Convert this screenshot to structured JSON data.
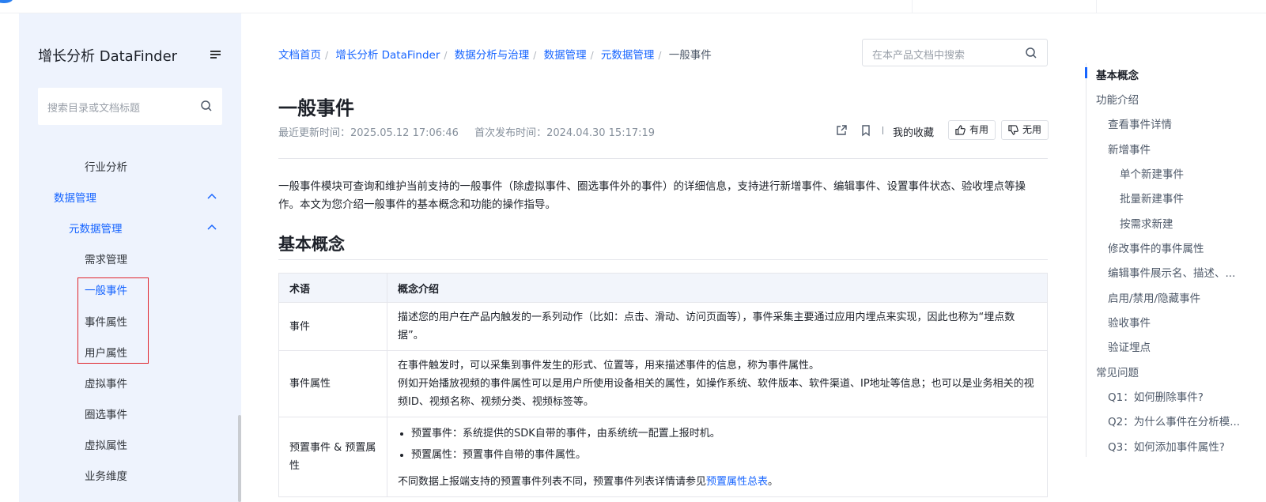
{
  "sidebar": {
    "title": "增长分析 DataFinder",
    "search_placeholder": "搜索目录或文档标题",
    "items": [
      {
        "label": "行业分析"
      },
      {
        "label": "数据管理"
      },
      {
        "label": "元数据管理"
      },
      {
        "label": "需求管理"
      },
      {
        "label": "一般事件"
      },
      {
        "label": "事件属性"
      },
      {
        "label": "用户属性"
      },
      {
        "label": "虚拟事件"
      },
      {
        "label": "圈选事件"
      },
      {
        "label": "虚拟属性"
      },
      {
        "label": "业务维度"
      }
    ]
  },
  "breadcrumb": [
    "文档首页",
    "增长分析 DataFinder",
    "数据分析与治理",
    "数据管理",
    "元数据管理",
    "一般事件"
  ],
  "doc_search_placeholder": "在本产品文档中搜索",
  "doc": {
    "title": "一般事件",
    "updated": "最近更新时间：2025.05.12 17:06:46",
    "published": "首次发布时间：2024.04.30 15:17:19",
    "favorites": "我的收藏",
    "useful": "有用",
    "useless": "无用",
    "intro": "一般事件模块可查询和维护当前支持的一般事件（除虚拟事件、圈选事件外的事件）的详细信息，支持进行新增事件、编辑事件、设置事件状态、验收埋点等操作。本文为您介绍一般事件的基本概念和功能的操作指导。",
    "section_title": "基本概念",
    "table": {
      "headers": [
        "术语",
        "概念介绍"
      ],
      "rows": [
        {
          "term": "事件",
          "desc": "描述您的用户在产品内触发的一系列动作（比如：点击、滑动、访问页面等），事件采集主要通过应用内埋点来实现，因此也称为“埋点数据”。"
        },
        {
          "term": "事件属性",
          "desc1": "在事件触发时，可以采集到事件发生的形式、位置等，用来描述事件的信息，称为事件属性。",
          "desc2": "例如开始播放视频的事件属性可以是用户所使用设备相关的属性，如操作系统、软件版本、软件渠道、IP地址等信息；也可以是业务相关的视频ID、视频名称、视频分类、视频标签等。"
        },
        {
          "term": "预置事件 & 预置属性",
          "bullet1": "预置事件：系统提供的SDK自带的事件，由系统统一配置上报时机。",
          "bullet2": "预置属性：预置事件自带的事件属性。",
          "note_prefix": "不同数据上报端支持的预置事件列表不同，预置事件列表详情请参见",
          "note_link": "预置属性总表",
          "note_suffix": "。"
        }
      ]
    }
  },
  "toc": [
    "基本概念",
    "功能介绍",
    "查看事件详情",
    "新增事件",
    "单个新建事件",
    "批量新建事件",
    "按需求新建",
    "修改事件的事件属性",
    "编辑事件展示名、描述、...",
    "启用/禁用/隐藏事件",
    "验收事件",
    "验证埋点",
    "常见问题",
    "Q1：如何删除事件?",
    "Q2：为什么事件在分析模...",
    "Q3：如何添加事件属性?"
  ],
  "colors": {
    "accent": "#1664ff",
    "sidebar_bg": "#eef3fd",
    "highlight": "#e0242b"
  }
}
